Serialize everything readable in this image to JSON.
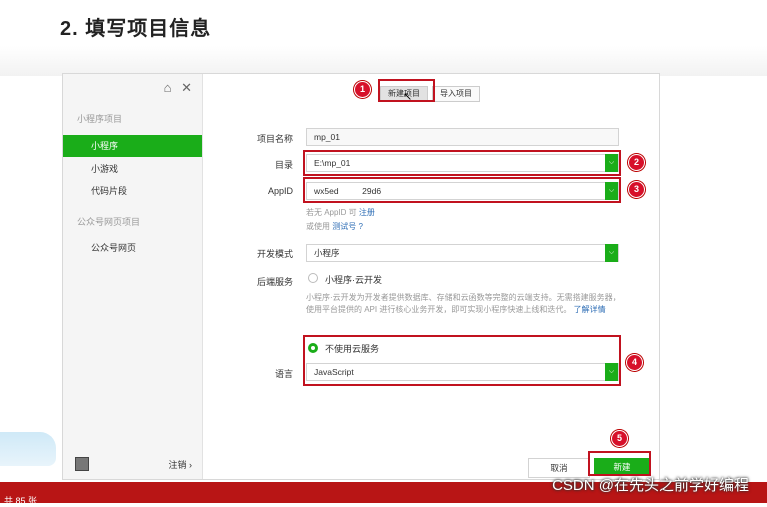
{
  "slide": {
    "title": "2. 填写项目信息"
  },
  "sidebar": {
    "icon1": "⌂",
    "icon2": "✕",
    "groups": [
      {
        "label": "小程序项目",
        "items": [
          "小程序",
          "小游戏",
          "代码片段"
        ]
      },
      {
        "label": "公众号网页项目",
        "items": [
          "公众号网页"
        ]
      }
    ],
    "active_item": "小程序",
    "logout": "注销 ›"
  },
  "tabs": {
    "new_project": "新建项目",
    "import_project": "导入项目"
  },
  "form": {
    "project_name": {
      "label": "项目名称",
      "value": "mp_01"
    },
    "directory": {
      "label": "目录",
      "value": "E:\\mp_01"
    },
    "appid": {
      "label": "AppID",
      "value": "wx5ed          29d6"
    },
    "appid_hint1_prefix": "若无 AppID 可",
    "appid_hint1_link": "注册",
    "appid_hint2_prefix": "或使用",
    "appid_hint2_link": "测试号",
    "appid_hint2_suffix": "?",
    "dev_mode": {
      "label": "开发模式",
      "value": "小程序"
    },
    "backend": {
      "label": "后端服务",
      "option": "小程序·云开发"
    },
    "backend_desc": "小程序·云开发为开发者提供数据库、存储和云函数等完整的云端支持。无需搭建服务器，使用平台提供的 API 进行核心业务开发，即可实现小程序快速上线和迭代。",
    "backend_desc_link": "了解详情",
    "no_cloud": "不使用云服务",
    "language": {
      "label": "语言",
      "value": "JavaScript"
    }
  },
  "buttons": {
    "cancel": "取消",
    "create": "新建"
  },
  "annotations": {
    "n1": "1",
    "n2": "2",
    "n3": "3",
    "n4": "4",
    "n5": "5"
  },
  "footer": {
    "left_text": "共 85 张",
    "watermark": "CSDN @在先头之前学好编程"
  },
  "colors": {
    "accent": "#1aad19",
    "highlight": "#c1121f",
    "taskbar": "#b81515"
  }
}
